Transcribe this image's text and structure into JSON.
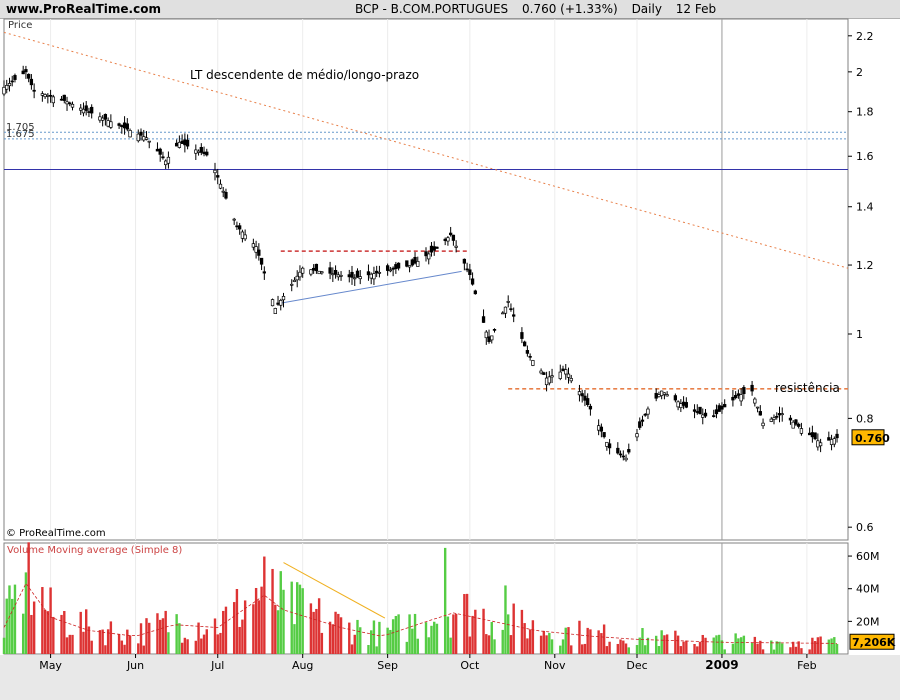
{
  "header": {
    "site": "www.ProRealTime.com",
    "ticker": "BCP - B.COM.PORTUGUES",
    "last": "0.760 (+1.33%)",
    "period": "Daily",
    "date": "12 Feb"
  },
  "chart_data": [
    {
      "type": "candlestick",
      "ylabel": "Price",
      "scale": "log",
      "ylim": [
        0.58,
        2.3
      ],
      "y_ticks": [
        "2.2",
        "2",
        "1.8",
        "1.6",
        "1.4",
        "1.2",
        "1",
        "0.8",
        "0.6"
      ],
      "current_value_label": "0.760",
      "watermark": "© ProRealTime.com",
      "x_months": [
        "May",
        "Jun",
        "Jul",
        "Aug",
        "Sep",
        "Oct",
        "Nov",
        "Dec",
        "2009",
        "Feb"
      ],
      "price_path": [
        {
          "date": "2008-04-14",
          "close": 1.92
        },
        {
          "date": "2008-04-22",
          "close": 2.0
        },
        {
          "date": "2008-04-25",
          "close": 1.9
        },
        {
          "date": "2008-05-05",
          "close": 1.86
        },
        {
          "date": "2008-05-20",
          "close": 1.77
        },
        {
          "date": "2008-06-05",
          "close": 1.68
        },
        {
          "date": "2008-06-12",
          "close": 1.58
        },
        {
          "date": "2008-06-17",
          "close": 1.66
        },
        {
          "date": "2008-06-28",
          "close": 1.6
        },
        {
          "date": "2008-07-08",
          "close": 1.33
        },
        {
          "date": "2008-07-15",
          "close": 1.26
        },
        {
          "date": "2008-07-22",
          "close": 1.07
        },
        {
          "date": "2008-08-01",
          "close": 1.19
        },
        {
          "date": "2008-08-20",
          "close": 1.16
        },
        {
          "date": "2008-09-10",
          "close": 1.2
        },
        {
          "date": "2008-09-20",
          "close": 1.26
        },
        {
          "date": "2008-09-24",
          "close": 1.3
        },
        {
          "date": "2008-10-01",
          "close": 1.17
        },
        {
          "date": "2008-10-08",
          "close": 0.98
        },
        {
          "date": "2008-10-15",
          "close": 1.09
        },
        {
          "date": "2008-10-22",
          "close": 0.95
        },
        {
          "date": "2008-10-29",
          "close": 0.89
        },
        {
          "date": "2008-11-05",
          "close": 0.91
        },
        {
          "date": "2008-11-14",
          "close": 0.82
        },
        {
          "date": "2008-11-21",
          "close": 0.74
        },
        {
          "date": "2008-11-27",
          "close": 0.72
        },
        {
          "date": "2008-12-05",
          "close": 0.82
        },
        {
          "date": "2008-12-10",
          "close": 0.86
        },
        {
          "date": "2008-12-20",
          "close": 0.82
        },
        {
          "date": "2008-12-28",
          "close": 0.8
        },
        {
          "date": "2009-01-07",
          "close": 0.85
        },
        {
          "date": "2009-01-12",
          "close": 0.86
        },
        {
          "date": "2009-01-16",
          "close": 0.79
        },
        {
          "date": "2009-01-23",
          "close": 0.81
        },
        {
          "date": "2009-02-01",
          "close": 0.77
        },
        {
          "date": "2009-02-06",
          "close": 0.75
        },
        {
          "date": "2009-02-12",
          "close": 0.76
        }
      ],
      "levels": [
        {
          "value": 1.705,
          "label": "1.705",
          "color": "#6699cc",
          "style": "dotted"
        },
        {
          "value": 1.675,
          "label": "1.675",
          "color": "#6699cc",
          "style": "dotted"
        },
        {
          "value": 1.545,
          "label": "",
          "color": "#3333aa",
          "style": "solid"
        }
      ],
      "annotations": [
        {
          "text": "LT descendente de médio/longo-prazo",
          "color": "#e8804a",
          "from": {
            "date": "2008-04-14",
            "value": 2.22
          },
          "to": {
            "date": "2009-02-16",
            "value": 1.19
          },
          "style": "dotted"
        },
        {
          "text": "resistência",
          "color": "#e8804a",
          "from": {
            "date": "2008-10-15",
            "value": 0.865
          },
          "to": {
            "date": "2009-02-16",
            "value": 0.865
          },
          "style": "dashed"
        },
        {
          "text": "",
          "color": "#cc3333",
          "from": {
            "date": "2008-07-24",
            "value": 1.245
          },
          "to": {
            "date": "2008-09-30",
            "value": 1.245
          },
          "style": "dashed"
        },
        {
          "text": "",
          "color": "#6688cc",
          "from": {
            "date": "2008-07-24",
            "value": 1.085
          },
          "to": {
            "date": "2008-09-28",
            "value": 1.18
          },
          "style": "solid"
        }
      ]
    },
    {
      "type": "bar",
      "title": "Volume Moving average (Simple 8)",
      "unit": "M",
      "ylim": [
        0,
        68
      ],
      "y_ticks": [
        "60M",
        "40M",
        "20M"
      ],
      "current_value_label": "7,206K",
      "volume_path": [
        {
          "date": "2008-04-14",
          "value": 18
        },
        {
          "date": "2008-04-22",
          "value": 48
        },
        {
          "date": "2008-05-01",
          "value": 25
        },
        {
          "date": "2008-05-15",
          "value": 16
        },
        {
          "date": "2008-06-01",
          "value": 12
        },
        {
          "date": "2008-06-15",
          "value": 20
        },
        {
          "date": "2008-07-01",
          "value": 18
        },
        {
          "date": "2008-07-18",
          "value": 40
        },
        {
          "date": "2008-07-25",
          "value": 30
        },
        {
          "date": "2008-08-15",
          "value": 18
        },
        {
          "date": "2008-08-30",
          "value": 12
        },
        {
          "date": "2008-09-15",
          "value": 22
        },
        {
          "date": "2008-09-25",
          "value": 28
        },
        {
          "date": "2008-10-10",
          "value": 22
        },
        {
          "date": "2008-10-25",
          "value": 16
        },
        {
          "date": "2008-11-15",
          "value": 12
        },
        {
          "date": "2008-12-01",
          "value": 10
        },
        {
          "date": "2009-01-01",
          "value": 8
        },
        {
          "date": "2009-02-12",
          "value": 7.2
        }
      ],
      "spikes": [
        {
          "date": "2008-04-20",
          "value": 52
        },
        {
          "date": "2008-04-22",
          "value": 50
        },
        {
          "date": "2008-07-19",
          "value": 64
        },
        {
          "date": "2008-09-22",
          "value": 65
        },
        {
          "date": "2008-07-30",
          "value": 44
        },
        {
          "date": "2008-10-14",
          "value": 42
        }
      ],
      "annotations": [
        {
          "text": "",
          "color": "#f0b020",
          "from": {
            "date": "2008-07-25",
            "value": 56
          },
          "to": {
            "date": "2008-08-31",
            "value": 22
          },
          "style": "solid"
        }
      ]
    }
  ]
}
